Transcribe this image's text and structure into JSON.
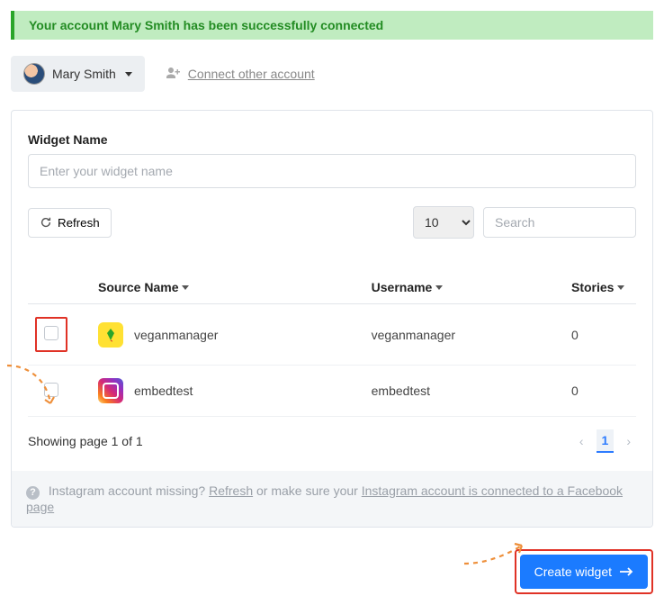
{
  "alert": {
    "message": "Your account Mary Smith has been successfully connected"
  },
  "header": {
    "account_name": "Mary Smith",
    "connect_label": "Connect other account"
  },
  "widget": {
    "name_label": "Widget Name",
    "name_placeholder": "Enter your widget name",
    "refresh_label": "Refresh",
    "per_page_value": "10",
    "search_placeholder": "Search"
  },
  "table": {
    "col_source": "Source Name",
    "col_user": "Username",
    "col_stories": "Stories",
    "rows": [
      {
        "source": "veganmanager",
        "username": "veganmanager",
        "stories": "0"
      },
      {
        "source": "embedtest",
        "username": "embedtest",
        "stories": "0"
      }
    ]
  },
  "pagination": {
    "summary": "Showing page 1 of 1",
    "current": "1"
  },
  "help": {
    "prefix": "Instagram account missing? ",
    "refresh": "Refresh",
    "middle": " or make sure your ",
    "link": "Instagram account is connected to a Facebook page"
  },
  "create_button": "Create widget"
}
